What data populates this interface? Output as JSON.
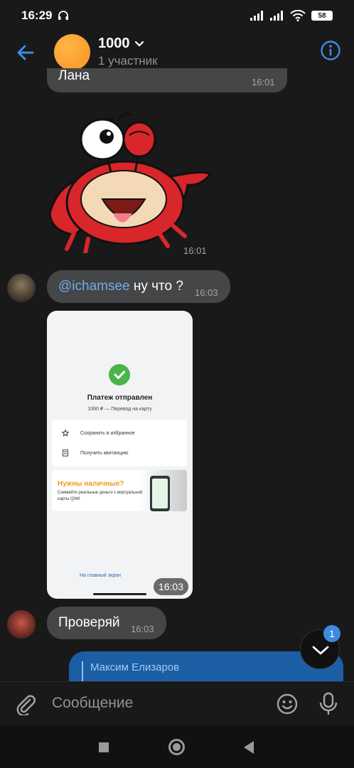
{
  "status_bar": {
    "time": "16:29",
    "battery": "58"
  },
  "header": {
    "title": "1000",
    "subtitle": "1 участник"
  },
  "messages": {
    "top_partial": {
      "text": "Лана",
      "time": "16:01"
    },
    "sticker": {
      "time": "16:01"
    },
    "mention_msg": {
      "mention": "@ichamsee",
      "text": " ну что ?",
      "time": "16:03"
    },
    "screenshot": {
      "title": "Платеж отправлен",
      "subtitle": "1060 ₽ — Перевод на карту",
      "row1": "Сохранить в избранное",
      "row2": "Получить квитанцию",
      "banner_title": "Нужны наличные?",
      "banner_sub": "Снимайте реальные деньги с виртуальной карты QIWI",
      "link": "На главный экран",
      "time": "16:03"
    },
    "check_msg": {
      "text": "Проверяй",
      "time": "16:03"
    },
    "outgoing": {
      "reply_name": "Максим Елизаров"
    }
  },
  "scroll_fab": {
    "badge": "1"
  },
  "composer": {
    "placeholder": "Сообщение"
  },
  "colors": {
    "accent": "#3f8ae0",
    "mention": "#71aaeb",
    "bubble_in": "#454647",
    "bubble_out": "#1c5ea3",
    "check": "#4bb34b"
  }
}
